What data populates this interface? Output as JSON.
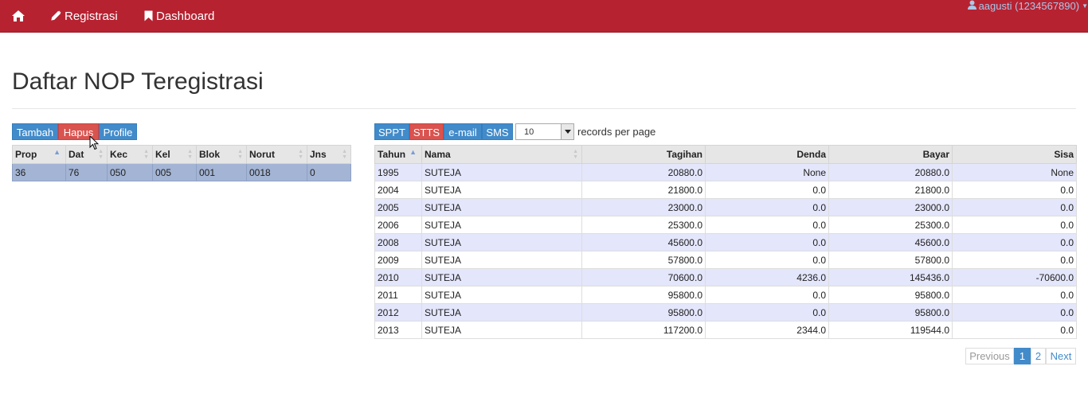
{
  "navbar": {
    "home_icon": "home-icon",
    "registrasi_label": "Registrasi",
    "registrasi_icon": "pencil-icon",
    "dashboard_label": "Dashboard",
    "dashboard_icon": "bookmark-icon",
    "user_label": "aagusti (1234567890)",
    "user_icon": "user-icon",
    "bg_color": "#b72231"
  },
  "page": {
    "title": "Daftar NOP Teregistrasi"
  },
  "left_toolbar": {
    "tambah": "Tambah",
    "hapus": "Hapus",
    "profile": "Profile"
  },
  "nop_table": {
    "headers": [
      "Prop",
      "Dat",
      "Kec",
      "Kel",
      "Blok",
      "Norut",
      "Jns"
    ],
    "rows": [
      [
        "36",
        "76",
        "050",
        "005",
        "001",
        "0018",
        "0"
      ]
    ]
  },
  "right_toolbar": {
    "sppt": "SPPT",
    "stts": "STTS",
    "email": "e-mail",
    "sms": "SMS",
    "records_value": "10",
    "records_label": "records per page"
  },
  "tagihan_table": {
    "headers": [
      "Tahun",
      "Nama",
      "Tagihan",
      "Denda",
      "Bayar",
      "Sisa"
    ],
    "rows": [
      [
        "1995",
        "SUTEJA",
        "20880.0",
        "None",
        "20880.0",
        "None"
      ],
      [
        "2004",
        "SUTEJA",
        "21800.0",
        "0.0",
        "21800.0",
        "0.0"
      ],
      [
        "2005",
        "SUTEJA",
        "23000.0",
        "0.0",
        "23000.0",
        "0.0"
      ],
      [
        "2006",
        "SUTEJA",
        "25300.0",
        "0.0",
        "25300.0",
        "0.0"
      ],
      [
        "2008",
        "SUTEJA",
        "45600.0",
        "0.0",
        "45600.0",
        "0.0"
      ],
      [
        "2009",
        "SUTEJA",
        "57800.0",
        "0.0",
        "57800.0",
        "0.0"
      ],
      [
        "2010",
        "SUTEJA",
        "70600.0",
        "4236.0",
        "145436.0",
        "-70600.0"
      ],
      [
        "2011",
        "SUTEJA",
        "95800.0",
        "0.0",
        "95800.0",
        "0.0"
      ],
      [
        "2012",
        "SUTEJA",
        "95800.0",
        "0.0",
        "95800.0",
        "0.0"
      ],
      [
        "2013",
        "SUTEJA",
        "117200.0",
        "2344.0",
        "119544.0",
        "0.0"
      ]
    ]
  },
  "pagination": {
    "previous": "Previous",
    "page1": "1",
    "page2": "2",
    "next": "Next"
  }
}
